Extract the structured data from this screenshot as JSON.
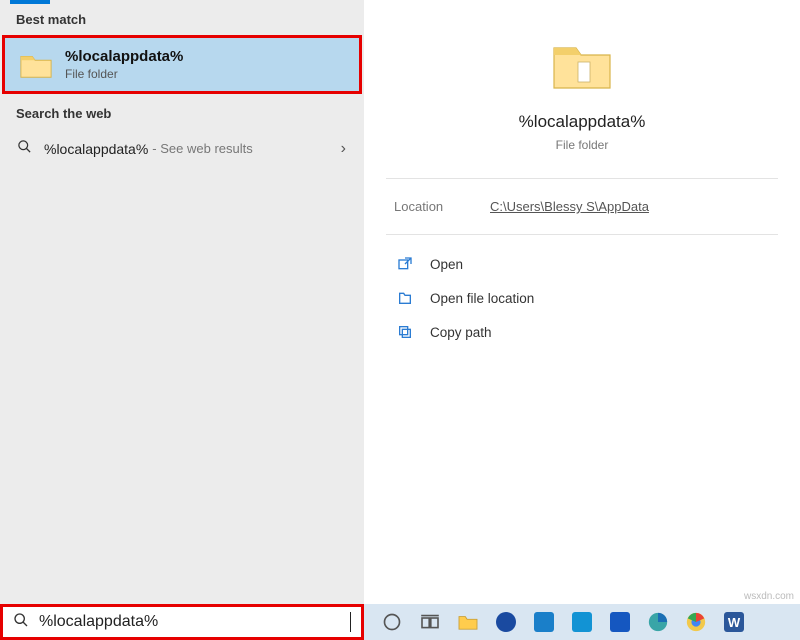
{
  "left": {
    "best_match_label": "Best match",
    "best_match": {
      "title": "%localappdata%",
      "subtitle": "File folder"
    },
    "web_label": "Search the web",
    "web_result": {
      "query": "%localappdata%",
      "hint": " - See web results"
    }
  },
  "right": {
    "title": "%localappdata%",
    "subtitle": "File folder",
    "location_label": "Location",
    "location_value": "C:\\Users\\Blessy S\\AppData",
    "actions": {
      "open": "Open",
      "open_location": "Open file location",
      "copy_path": "Copy path"
    }
  },
  "search": {
    "value": "%localappdata%"
  },
  "watermark": "wsxdn.com"
}
